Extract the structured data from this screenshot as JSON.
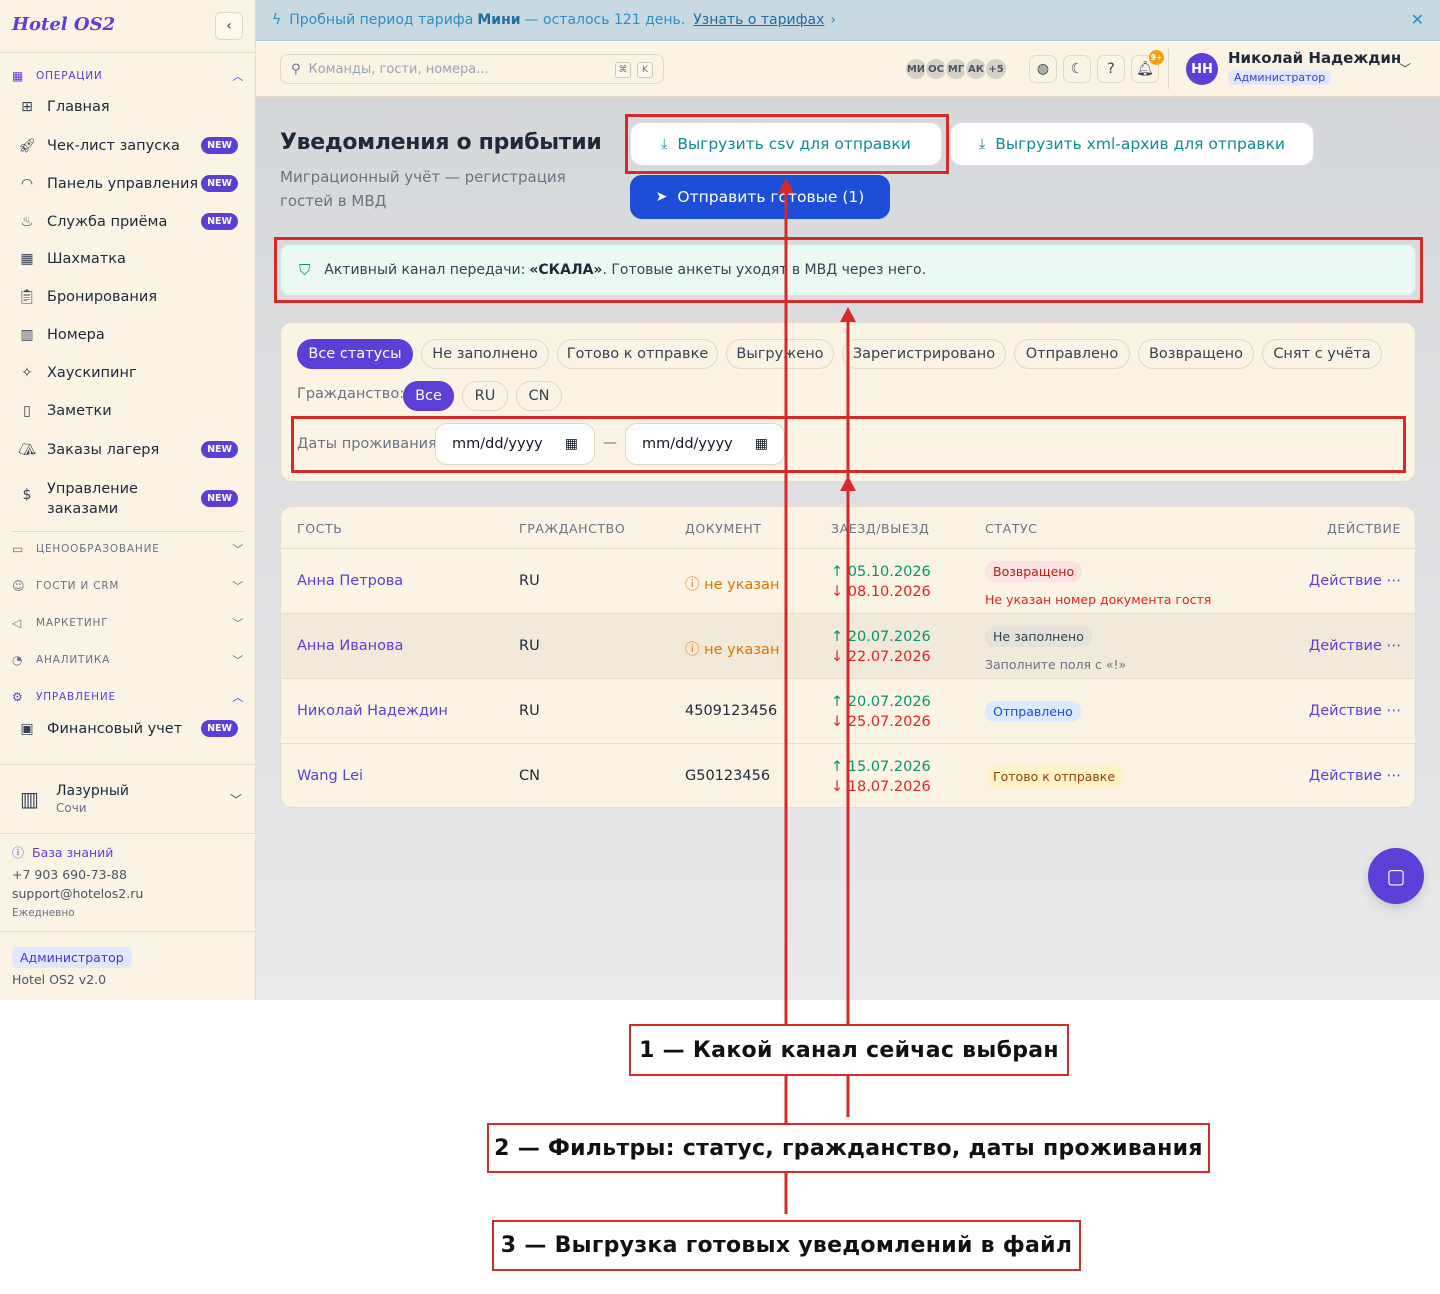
{
  "sidebar": {
    "brand": "Hotel OS2",
    "sections": {
      "operations": "ОПЕРАЦИИ",
      "pricing": "ЦЕНООБРАЗОВАНИЕ",
      "guests": "ГОСТИ И CRM",
      "marketing": "МАРКЕТИНГ",
      "analytics": "АНАЛИТИКА",
      "management": "УПРАВЛЕНИЕ"
    },
    "items": [
      {
        "label": "Главная",
        "new": false
      },
      {
        "label": "Чек-лист запуска",
        "new": true
      },
      {
        "label": "Панель управления",
        "new": true
      },
      {
        "label": "Служба приёма",
        "new": true
      },
      {
        "label": "Шахматка",
        "new": false
      },
      {
        "label": "Бронирования",
        "new": false
      },
      {
        "label": "Номера",
        "new": false
      },
      {
        "label": "Хаускипинг",
        "new": false
      },
      {
        "label": "Заметки",
        "new": false
      },
      {
        "label": "Заказы лагеря",
        "new": true
      },
      {
        "label": "Управление заказами",
        "new": true
      }
    ],
    "finance_item": "Финансовый учет",
    "new_badge": "NEW",
    "hotel": {
      "name": "Лазурный",
      "city": "Сочи"
    },
    "knowledge_base": "База знаний",
    "phone": "+7 903 690-73-88",
    "email": "support@hotelos2.ru",
    "schedule": "Ежедневно",
    "role": "Администратор",
    "version": "Hotel OS2 v2.0"
  },
  "trial": {
    "text_before": "Пробный период тарифа",
    "plan": "Мини",
    "text_after": "— осталось 121 день.",
    "link": "Узнать о тарифах"
  },
  "topbar": {
    "search_placeholder": "Команды, гости, номера...",
    "kbd_1": "⌘",
    "kbd_2": "K",
    "avatars": [
      "МИ",
      "ОС",
      "МГ",
      "АК",
      "+5"
    ],
    "notif_count": "9+",
    "user_initials": "НН",
    "user_name": "Николай Надеждин",
    "user_role": "Администратор"
  },
  "page": {
    "title": "Уведомления о прибытии",
    "subtitle": "Миграционный учёт — регистрация гостей в МВД",
    "btn_csv": "Выгрузить csv для отправки",
    "btn_xml": "Выгрузить xml-архив для отправки",
    "btn_send": "Отправить готовые (1)"
  },
  "channel": {
    "prefix": "Активный канал передачи:",
    "name": "«СКАЛА»",
    "suffix": ". Готовые анкеты уходят в МВД через него."
  },
  "filters": {
    "statuses": [
      "Все статусы",
      "Не заполнено",
      "Готово к отправке",
      "Выгружено",
      "Зарегистрировано",
      "Отправлено",
      "Возвращено",
      "Снят с учёта"
    ],
    "citizenship_label": "Гражданство:",
    "citizenship": [
      "Все",
      "RU",
      "CN"
    ],
    "dates_label": "Даты проживания:",
    "date_placeholder": "mm/dd/yyyy",
    "dash": "—"
  },
  "table": {
    "headers": {
      "guest": "ГОСТЬ",
      "citizenship": "ГРАЖДАНСТВО",
      "document": "ДОКУМЕНТ",
      "dates": "ЗАЕЗД/ВЫЕЗД",
      "status": "СТАТУС",
      "action": "ДЕЙСТВИЕ"
    },
    "rows": [
      {
        "guest": "Анна Петрова",
        "citizenship": "RU",
        "document": "не указан",
        "check_in": "05.10.2026",
        "check_out": "08.10.2026",
        "status": "Возвращено",
        "note": "Не указан номер документа гостя",
        "action": "Действие ⋯"
      },
      {
        "guest": "Анна Иванова",
        "citizenship": "RU",
        "document": "не указан",
        "check_in": "20.07.2026",
        "check_out": "22.07.2026",
        "status": "Не заполнено",
        "note": "Заполните поля с «!»",
        "action": "Действие ⋯"
      },
      {
        "guest": "Николай Надеждин",
        "citizenship": "RU",
        "document": "4509123456",
        "check_in": "20.07.2026",
        "check_out": "25.07.2026",
        "status": "Отправлено",
        "note": "",
        "action": "Действие ⋯"
      },
      {
        "guest": "Wang Lei",
        "citizenship": "CN",
        "document": "G50123456",
        "check_in": "15.07.2026",
        "check_out": "18.07.2026",
        "status": "Готово к отправке",
        "note": "",
        "action": "Действие ⋯"
      }
    ]
  },
  "annotations": [
    "1 — Какой канал сейчас выбран",
    "2 — Фильтры: статус, гражданство, даты проживания",
    "3 — Выгрузка готовых уведомлений в файл"
  ],
  "colors": {
    "accent": "#5b3fd6",
    "primary_button": "#1d4ed8",
    "annotation": "#d42a2a",
    "sidebar_bg": "#fbf3e4"
  }
}
